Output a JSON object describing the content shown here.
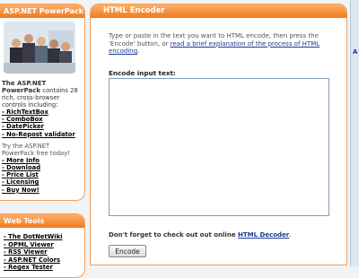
{
  "powerpack": {
    "title": "ASP.NET PowerPack",
    "desc_bold": "The ASP.NET PowerPack",
    "desc_rest": " contains 28 rich, cross-browser controls including:",
    "controls": [
      "- RichTextBox",
      "- ComboBox",
      "- DatePicker",
      "- No-Repost validator"
    ],
    "try_text": "Try the ASP.NET PowerPack free today!",
    "links": [
      "- More Info",
      "- Download",
      "- Price List",
      "- Licensing",
      "- Buy Now!"
    ]
  },
  "webtools": {
    "title": "Web Tools",
    "items": [
      "- The DotNetWiki",
      "- OPML Viewer",
      "- RSS Viewer",
      "- ASP.NET Colors",
      "- Regex Tester"
    ]
  },
  "encoder": {
    "title": "HTML Encoder",
    "intro_text": "Type or paste in the text you want to HTML encode, then press the 'Encode' button, or ",
    "intro_link": "read a brief explanation of the process of HTML encoding",
    "intro_end": ".",
    "input_label": "Encode input text:",
    "input_value": "",
    "note_text": "Don't forget to check out out online ",
    "note_link": "HTML Decoder",
    "note_end": ".",
    "button_label": "Encode"
  },
  "right_strip": {
    "letter": "A"
  },
  "colors": {
    "accent_orange": "#f07a1e",
    "link_blue": "#1a3d8f",
    "border_orange": "#f0a060"
  }
}
